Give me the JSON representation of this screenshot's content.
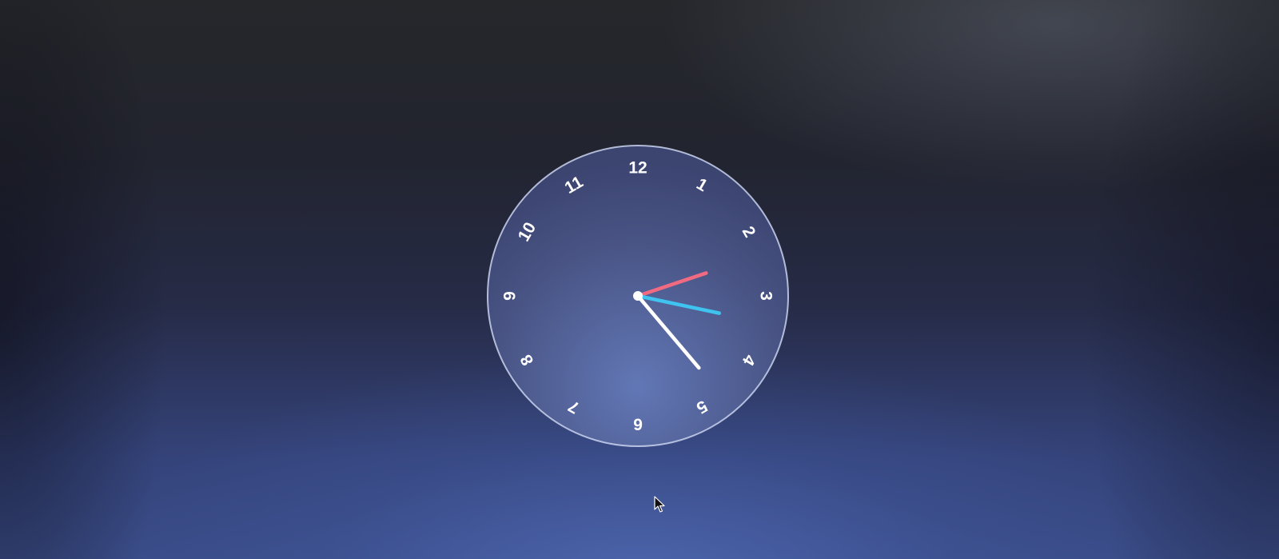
{
  "desktop": {
    "background_top": "#26272b",
    "background_bottom": "#3a4c88"
  },
  "clock": {
    "numerals": [
      "12",
      "1",
      "2",
      "3",
      "4",
      "5",
      "6",
      "7",
      "8",
      "9",
      "10",
      "11"
    ],
    "face_color": "#4a5585",
    "rim_color": "#c9d2ee",
    "time": {
      "hours": 2,
      "minutes": 23,
      "seconds": 17
    },
    "hands": {
      "hour": {
        "color": "#f06b82"
      },
      "minute": {
        "color": "#ffffff"
      },
      "second": {
        "color": "#3fc4f0"
      }
    }
  },
  "cursor": {
    "icon": "arrow-pointer-icon"
  }
}
